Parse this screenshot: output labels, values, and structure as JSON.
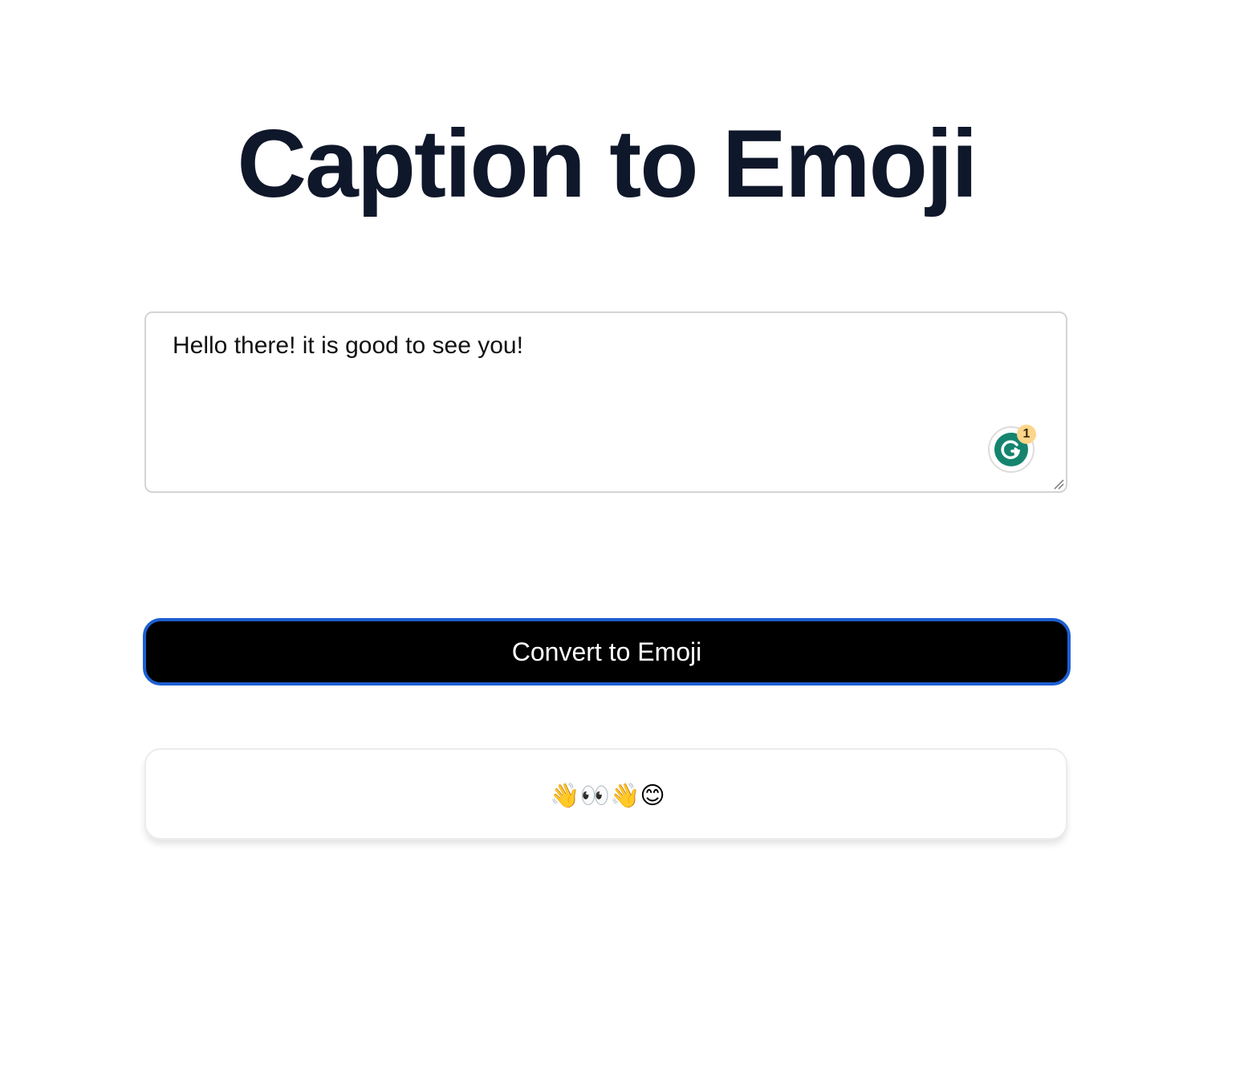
{
  "page": {
    "title": "Caption to Emoji"
  },
  "caption_input": {
    "value": "Hello there! it is good to see you!"
  },
  "grammarly": {
    "badge_count": "1",
    "icon": "grammarly-icon",
    "color": "#15846f"
  },
  "convert_button": {
    "label": "Convert to Emoji"
  },
  "output": {
    "text": "👋👀👋😊"
  },
  "colors": {
    "title": "#0f172a",
    "button_bg": "#000000",
    "button_border": "#1d5fd0"
  }
}
